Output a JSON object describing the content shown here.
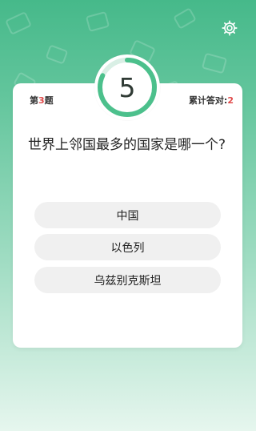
{
  "header": {
    "settings_icon": "gear-icon"
  },
  "timer": {
    "value": "5",
    "ring_color": "#4cc08c",
    "track_color": "#d9efe5",
    "progress": 0.82
  },
  "question_number": {
    "prefix": "第",
    "number": "3",
    "suffix": "题"
  },
  "score": {
    "label": "累计答对:",
    "value": "2"
  },
  "question": {
    "text": "世界上邻国最多的国家是哪一个?"
  },
  "options": [
    {
      "label": "中国"
    },
    {
      "label": "以色列"
    },
    {
      "label": "乌兹别克斯坦"
    }
  ],
  "colors": {
    "accent": "#4cc08c",
    "highlight": "#e04a4a"
  }
}
